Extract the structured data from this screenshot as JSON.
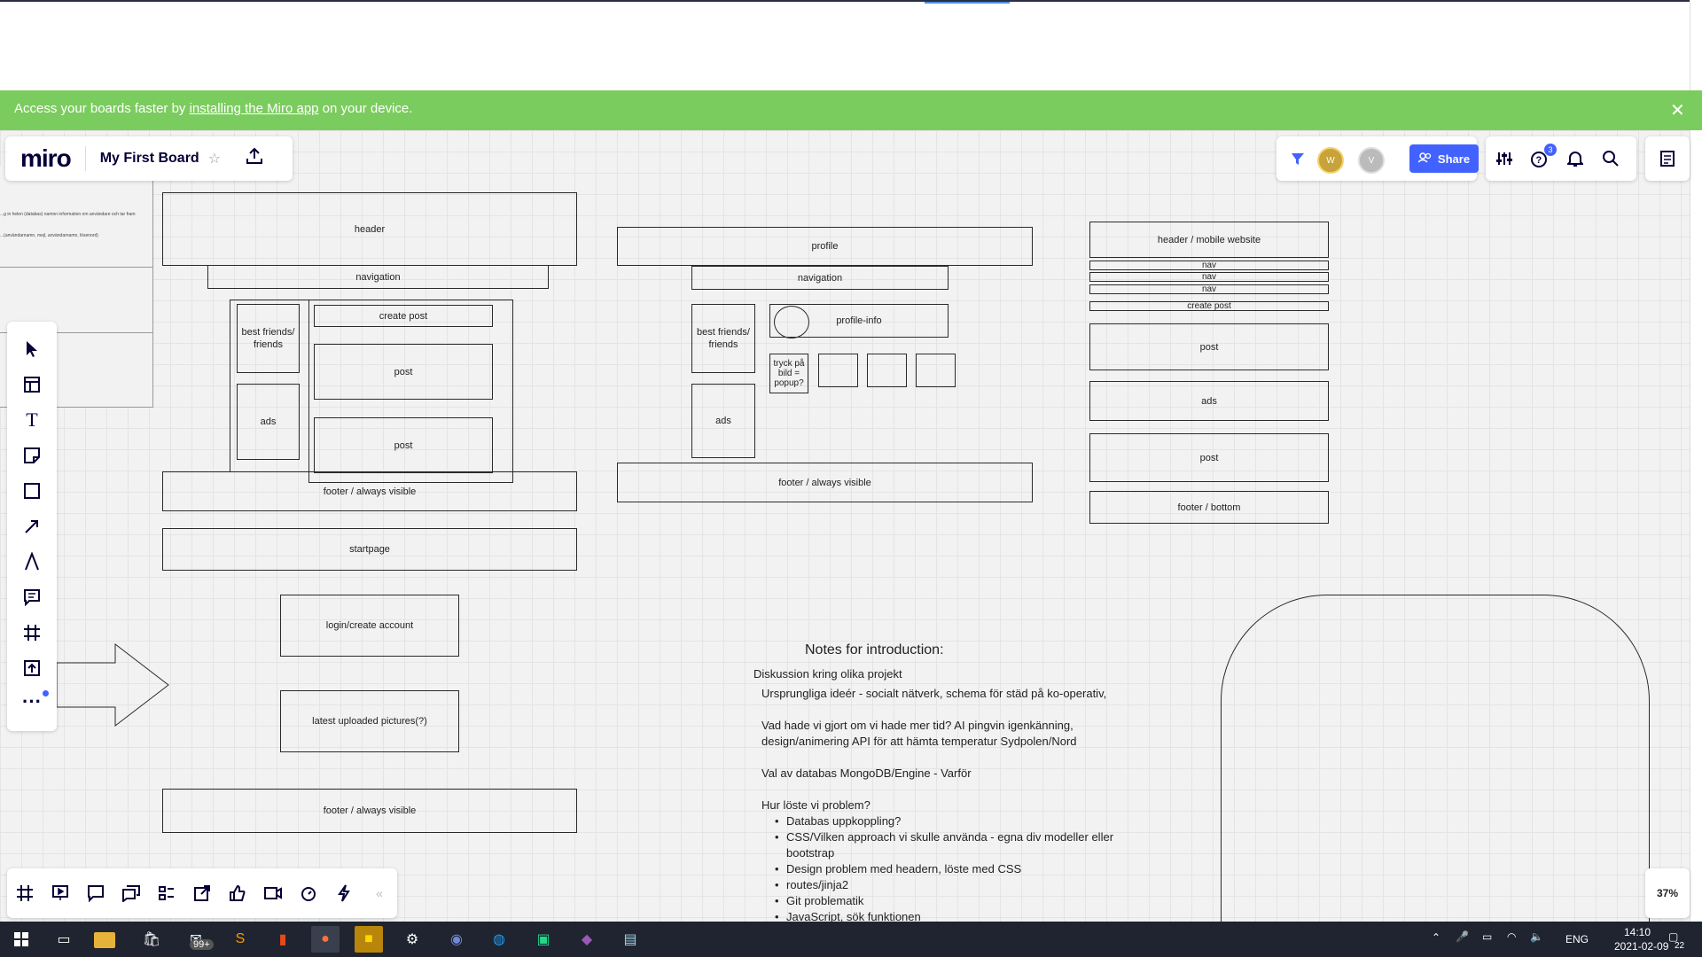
{
  "banner": {
    "text_before": "Access your boards faster by ",
    "link": "installing the Miro app",
    "text_after": " on your device."
  },
  "board": {
    "logo": "miro",
    "title": "My First Board"
  },
  "toolbar": {
    "share_label": "Share",
    "notification_count": "3",
    "avatars": [
      "W",
      "V"
    ]
  },
  "zoom": "37%",
  "wireframes": {
    "desktop": {
      "header": "header",
      "navigation": "navigation",
      "friends": "best friends/ friends",
      "ads": "ads",
      "create_post": "create post",
      "post1": "post",
      "post2": "post",
      "footer": "footer / always visible",
      "startpage": "startpage",
      "login": "login/create account",
      "latest": "latest uploaded pictures(?)",
      "footer2": "footer / always visible"
    },
    "profile": {
      "profile": "profile",
      "navigation": "navigation",
      "friends": "best friends/ friends",
      "profile_info": "profile-info",
      "popup": "tryck på bild = popup?",
      "ads": "ads",
      "footer": "footer / always visible"
    },
    "mobile": {
      "header": "header / mobile website",
      "nav1": "nav",
      "nav2": "nav",
      "nav3": "nav",
      "create_post": "create post",
      "post1": "post",
      "ads": "ads",
      "post2": "post",
      "footer": "footer / bottom"
    }
  },
  "side_panel": {
    "line1": "...g in helen (databas) namnn information om användare och tar fram",
    "line2": "...(användarnamn, mejl, användarnamn, lösenord)"
  },
  "notes": {
    "title": "Notes for introduction:",
    "subtitle": "Diskussion kring olika projekt",
    "lines": [
      "Ursprungliga ideér - socialt nätverk, schema för städ på ko-operativ,",
      "Vad hade vi gjort om vi hade mer tid? AI pingvin igenkänning,",
      "design/animering API för att hämta temperatur Sydpolen/Nord",
      "Val av databas MongoDB/Engine - Varför",
      "Hur löste vi problem?"
    ],
    "bullets": [
      "Databas uppkoppling?",
      "CSS/Vilken approach vi skulle använda - egna  div modeller eller",
      "bootstrap",
      "Design problem med headern, löste med CSS",
      "routes/jinja2",
      "Git problematik",
      "JavaScript, sök funktionen"
    ]
  },
  "taskbar": {
    "mail_badge": "99+",
    "lang": "ENG",
    "time": "14:10",
    "date": "2021-02-09",
    "notif_count": "22"
  }
}
